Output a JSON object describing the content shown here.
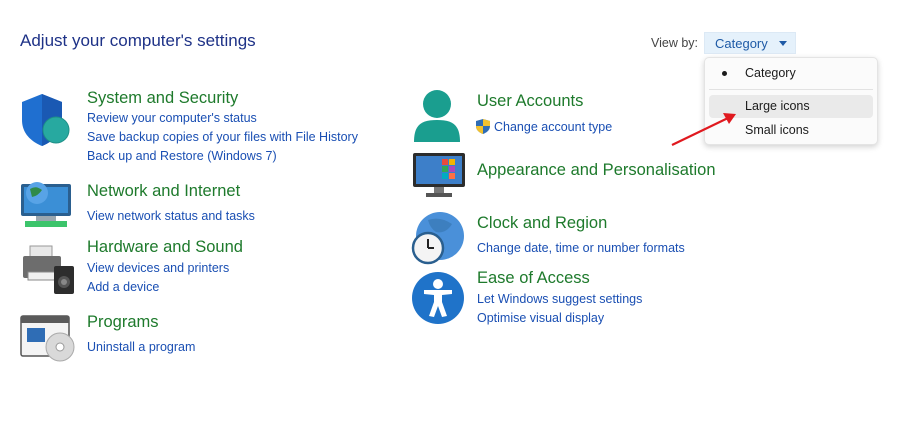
{
  "page": {
    "title": "Adjust your computer's settings"
  },
  "view_by": {
    "label": "View by:",
    "selected": "Category",
    "menu": [
      {
        "label": "Category",
        "selected": true
      },
      {
        "label": "Large icons",
        "hovered": true
      },
      {
        "label": "Small icons"
      }
    ]
  },
  "left_categories": [
    {
      "title": "System and Security",
      "icon": "shield-icon",
      "links": [
        "Review your computer's status",
        "Save backup copies of your files with File History",
        "Back up and Restore (Windows 7)"
      ]
    },
    {
      "title": "Network and Internet",
      "icon": "network-globe-icon",
      "links": [
        "View network status and tasks"
      ]
    },
    {
      "title": "Hardware and Sound",
      "icon": "printer-speaker-icon",
      "links": [
        "View devices and printers",
        "Add a device"
      ]
    },
    {
      "title": "Programs",
      "icon": "programs-disc-icon",
      "links": [
        "Uninstall a program"
      ]
    }
  ],
  "right_categories": [
    {
      "title": "User Accounts",
      "icon": "user-icon",
      "links": [
        "Change account type"
      ]
    },
    {
      "title": "Appearance and Personalisation",
      "icon": "monitor-tiles-icon",
      "links": []
    },
    {
      "title": "Clock and Region",
      "icon": "clock-globe-icon",
      "links": [
        "Change date, time or number formats"
      ]
    },
    {
      "title": "Ease of Access",
      "icon": "accessibility-icon",
      "links": [
        "Let Windows suggest settings",
        "Optimise visual display"
      ]
    }
  ],
  "colors": {
    "title_blue": "#1e3287",
    "category_green": "#1e7a2c",
    "link_blue": "#1a4fb3",
    "annotation_arrow": "#e0191f"
  }
}
